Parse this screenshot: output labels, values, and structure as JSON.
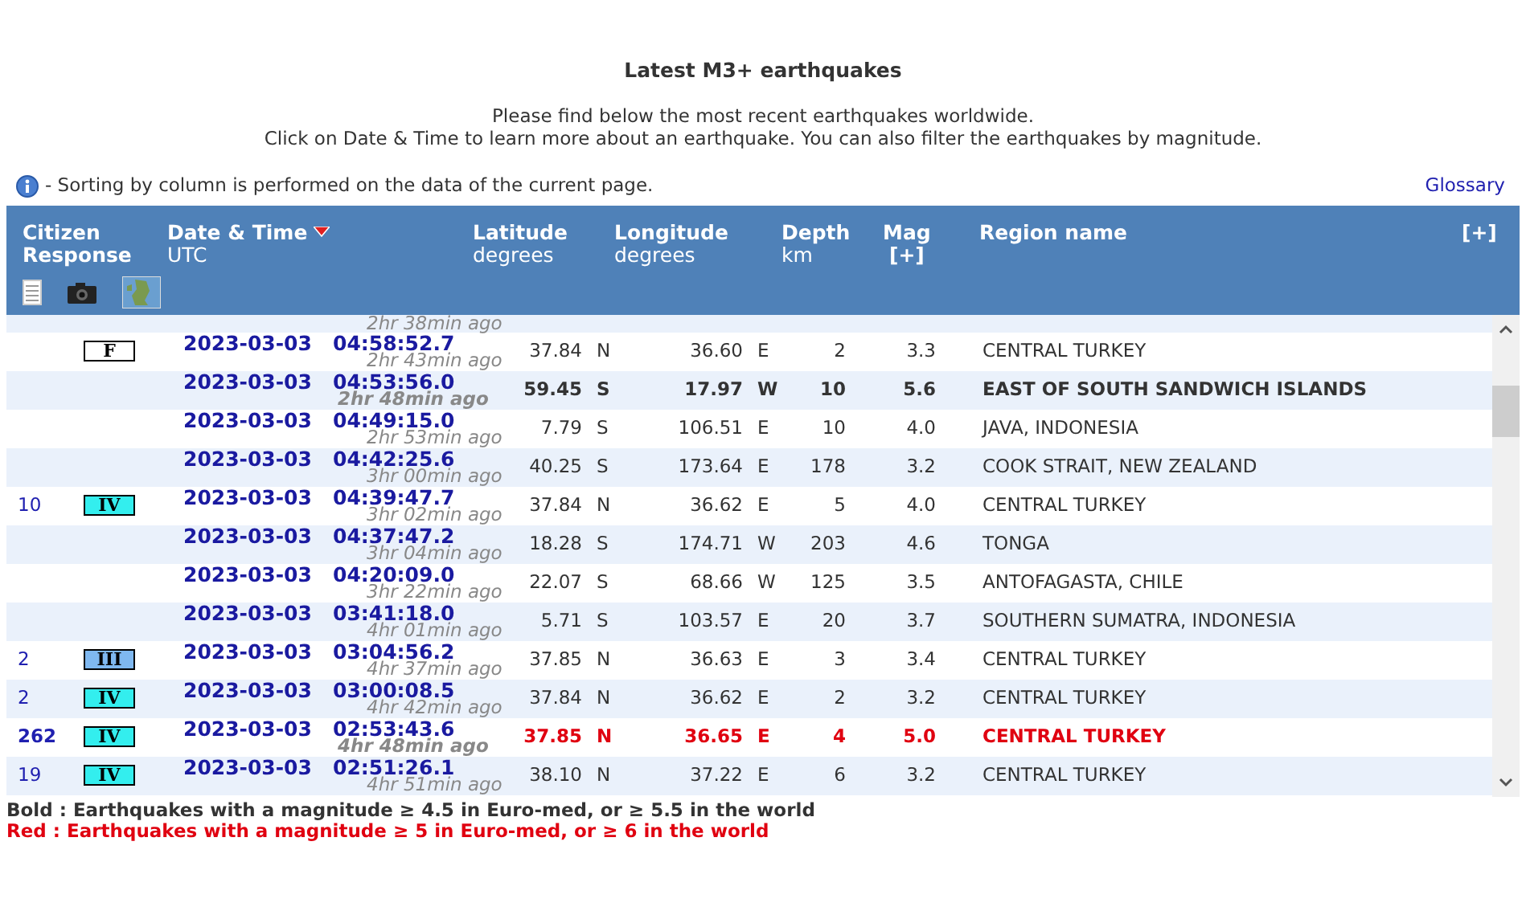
{
  "title": "Latest M3+ earthquakes",
  "intro": [
    "Please find below the most recent earthquakes worldwide.",
    "Click on Date & Time to learn more about an earthquake. You can also filter the earthquakes by magnitude."
  ],
  "note": "- Sorting by column is performed on the data of the current page.",
  "glossary": "Glossary",
  "header": {
    "citizen": [
      "Citizen",
      "Response"
    ],
    "datetime": "Date & Time",
    "datetime_unit": "UTC",
    "sorted_descending": true,
    "latitude": "Latitude",
    "latitude_unit": "degrees",
    "longitude": "Longitude",
    "longitude_unit": "degrees",
    "depth": "Depth",
    "depth_unit": "km",
    "mag": "Mag",
    "mag_filter": "[+]",
    "region": "Region name",
    "more": "[+]"
  },
  "rows": [
    {
      "partial": true,
      "ago": "2hr 38min ago",
      "bold": false,
      "red": false
    },
    {
      "partial": false,
      "intensity": "F",
      "color": "#ffffff",
      "date": "2023-03-03",
      "time": "04:58:52.7",
      "ago": "2hr 43min ago",
      "lat": "37.84",
      "lat_dir": "N",
      "lon": "36.60",
      "lon_dir": "E",
      "depth": "2",
      "mag": "3.3",
      "region": "CENTRAL TURKEY",
      "bold": false,
      "red": false
    },
    {
      "partial": false,
      "date": "2023-03-03",
      "time": "04:53:56.0",
      "ago": "2hr 48min ago",
      "lat": "59.45",
      "lat_dir": "S",
      "lon": "17.97",
      "lon_dir": "W",
      "depth": "10",
      "mag": "5.6",
      "region": "EAST OF SOUTH SANDWICH ISLANDS",
      "bold": true,
      "red": false
    },
    {
      "partial": false,
      "date": "2023-03-03",
      "time": "04:49:15.0",
      "ago": "2hr 53min ago",
      "lat": "7.79",
      "lat_dir": "S",
      "lon": "106.51",
      "lon_dir": "E",
      "depth": "10",
      "mag": "4.0",
      "region": "JAVA, INDONESIA",
      "bold": false,
      "red": false
    },
    {
      "partial": false,
      "date": "2023-03-03",
      "time": "04:42:25.6",
      "ago": "3hr 00min ago",
      "lat": "40.25",
      "lat_dir": "S",
      "lon": "173.64",
      "lon_dir": "E",
      "depth": "178",
      "mag": "3.2",
      "region": "COOK STRAIT, NEW ZEALAND",
      "bold": false,
      "red": false
    },
    {
      "partial": false,
      "count": "10",
      "intensity": "IV",
      "color": "#33eeee",
      "date": "2023-03-03",
      "time": "04:39:47.7",
      "ago": "3hr 02min ago",
      "lat": "37.84",
      "lat_dir": "N",
      "lon": "36.62",
      "lon_dir": "E",
      "depth": "5",
      "mag": "4.0",
      "region": "CENTRAL TURKEY",
      "bold": false,
      "red": false
    },
    {
      "partial": false,
      "date": "2023-03-03",
      "time": "04:37:47.2",
      "ago": "3hr 04min ago",
      "lat": "18.28",
      "lat_dir": "S",
      "lon": "174.71",
      "lon_dir": "W",
      "depth": "203",
      "mag": "4.6",
      "region": "TONGA",
      "bold": false,
      "red": false
    },
    {
      "partial": false,
      "date": "2023-03-03",
      "time": "04:20:09.0",
      "ago": "3hr 22min ago",
      "lat": "22.07",
      "lat_dir": "S",
      "lon": "68.66",
      "lon_dir": "W",
      "depth": "125",
      "mag": "3.5",
      "region": "ANTOFAGASTA, CHILE",
      "bold": false,
      "red": false
    },
    {
      "partial": false,
      "date": "2023-03-03",
      "time": "03:41:18.0",
      "ago": "4hr 01min ago",
      "lat": "5.71",
      "lat_dir": "S",
      "lon": "103.57",
      "lon_dir": "E",
      "depth": "20",
      "mag": "3.7",
      "region": "SOUTHERN SUMATRA, INDONESIA",
      "bold": false,
      "red": false
    },
    {
      "partial": false,
      "count": "2",
      "intensity": "III",
      "color": "#7fb8f0",
      "date": "2023-03-03",
      "time": "03:04:56.2",
      "ago": "4hr 37min ago",
      "lat": "37.85",
      "lat_dir": "N",
      "lon": "36.63",
      "lon_dir": "E",
      "depth": "3",
      "mag": "3.4",
      "region": "CENTRAL TURKEY",
      "bold": false,
      "red": false
    },
    {
      "partial": false,
      "count": "2",
      "intensity": "IV",
      "color": "#33eeee",
      "date": "2023-03-03",
      "time": "03:00:08.5",
      "ago": "4hr 42min ago",
      "lat": "37.84",
      "lat_dir": "N",
      "lon": "36.62",
      "lon_dir": "E",
      "depth": "2",
      "mag": "3.2",
      "region": "CENTRAL TURKEY",
      "bold": false,
      "red": false
    },
    {
      "partial": false,
      "count": "262",
      "intensity": "IV",
      "color": "#33eeee",
      "date": "2023-03-03",
      "time": "02:53:43.6",
      "ago": "4hr 48min ago",
      "lat": "37.85",
      "lat_dir": "N",
      "lon": "36.65",
      "lon_dir": "E",
      "depth": "4",
      "mag": "5.0",
      "region": "CENTRAL TURKEY",
      "bold": true,
      "red": true
    },
    {
      "partial": false,
      "count": "19",
      "intensity": "IV",
      "color": "#33eeee",
      "date": "2023-03-03",
      "time": "02:51:26.1",
      "ago": "4hr 51min ago",
      "lat": "38.10",
      "lat_dir": "N",
      "lon": "37.22",
      "lon_dir": "E",
      "depth": "6",
      "mag": "3.2",
      "region": "CENTRAL TURKEY",
      "bold": false,
      "red": false
    }
  ],
  "legend": [
    {
      "kind": "bold",
      "text": "Bold : Earthquakes with a magnitude ≥ 4.5 in Euro-med, or ≥ 5.5 in the world"
    },
    {
      "kind": "red",
      "text": "Red : Earthquakes with a magnitude ≥ 5 in Euro-med, or ≥ 6 in the world"
    }
  ]
}
